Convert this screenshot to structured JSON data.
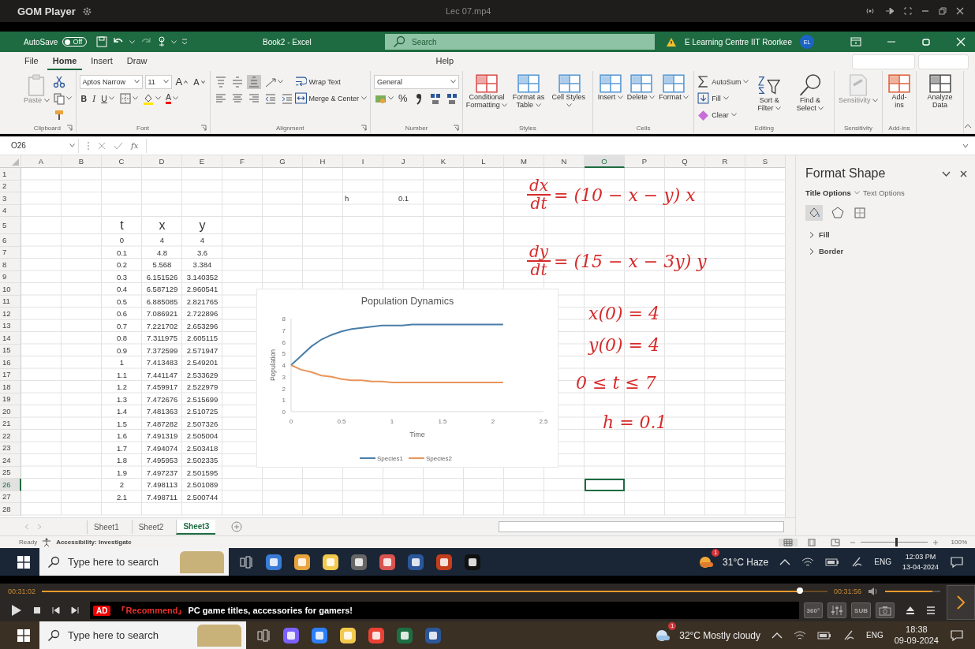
{
  "player": {
    "title": "GOM Player",
    "file": "Lec 07.mp4",
    "elapsed": "00:31:02",
    "total": "00:31:56",
    "seek": {
      "level": 0.965
    },
    "volume": {
      "level": 0.85
    },
    "ad_badge": "AD",
    "ad_tag": "『Recommend』",
    "ad_text": "PC game titles, accessories for gamers!",
    "buttons": [
      {
        "kind": "vr",
        "label": "360°"
      },
      {
        "kind": "equalizer"
      },
      {
        "kind": "subtitle",
        "label": "SUB"
      },
      {
        "kind": "capture"
      }
    ]
  },
  "excel": {
    "autosave": {
      "label": "AutoSave",
      "toggle": "Off",
      "on": false
    },
    "title": "Book2  -  Excel",
    "search": {
      "placeholder": "Search"
    },
    "account": {
      "name": "E Learning Centre IIT Roorkee",
      "initials": "EL"
    },
    "menu": [
      {
        "label": "File",
        "selected": false
      },
      {
        "label": "Home",
        "selected": true
      },
      {
        "label": "Insert",
        "selected": false
      },
      {
        "label": "Draw",
        "selected": false
      },
      {
        "label": "Help",
        "selected": false
      }
    ],
    "ribbon": [
      {
        "label": "Clipboard",
        "launcher": true,
        "blocks": [
          {
            "kind": "big",
            "label": "Paste",
            "disabled": true,
            "dropdown": true
          },
          {
            "kind": "stack",
            "lines": [
              [
                {
                  "kind": "cut"
                }
              ],
              [
                {
                  "kind": "copy",
                  "dropdown": true
                }
              ],
              [
                {
                  "kind": "painter"
                }
              ]
            ]
          }
        ]
      },
      {
        "label": "Font",
        "launcher": true,
        "blocks": [
          {
            "kind": "stack",
            "lines": [
              [
                {
                  "kind": "font-field",
                  "value": "Aptos Narrow"
                },
                {
                  "kind": "size-field",
                  "value": "11"
                },
                {
                  "kind": "grow",
                  "label": "A"
                },
                {
                  "kind": "shrink",
                  "label": "A"
                }
              ],
              [
                {
                  "kind": "bold",
                  "label": "B"
                },
                {
                  "kind": "italic",
                  "label": "I"
                },
                {
                  "kind": "underline",
                  "label": "U",
                  "dropdown": true
                },
                {
                  "kind": "borders",
                  "dropdown": true
                },
                {
                  "kind": "fill-color",
                  "dropdown": true
                },
                {
                  "kind": "font-color",
                  "label": "A",
                  "dropdown": true
                }
              ]
            ]
          }
        ]
      },
      {
        "label": "Alignment",
        "launcher": true,
        "blocks": [
          {
            "kind": "stack",
            "lines": [
              [
                {
                  "kind": "align-top",
                  "on": false
                },
                {
                  "kind": "align-middle",
                  "on": false
                },
                {
                  "kind": "align-bottom",
                  "on": true
                },
                {
                  "kind": "orientation",
                  "on": false,
                  "dropdown": true
                }
              ],
              [
                {
                  "kind": "align-left"
                },
                {
                  "kind": "align-center"
                },
                {
                  "kind": "align-right"
                },
                {
                  "kind": "indent-less"
                },
                {
                  "kind": "indent-more"
                }
              ]
            ]
          },
          {
            "kind": "stack",
            "lines": [
              [
                {
                  "kind": "small",
                  "label": "Wrap Text"
                }
              ],
              [
                {
                  "kind": "small",
                  "label": "Merge & Center",
                  "dropdown": true
                }
              ]
            ]
          }
        ]
      },
      {
        "label": "Number",
        "launcher": true,
        "blocks": [
          {
            "kind": "stack",
            "lines": [
              [
                {
                  "kind": "format-field",
                  "value": "General"
                }
              ],
              [
                {
                  "kind": "currency",
                  "dropdown": true
                },
                {
                  "kind": "percent",
                  "label": "%"
                },
                {
                  "kind": "comma"
                },
                {
                  "kind": "dec-more"
                },
                {
                  "kind": "dec-less"
                }
              ]
            ]
          }
        ]
      },
      {
        "label": "Styles",
        "launcher": false,
        "blocks": [
          {
            "kind": "big",
            "label": "Conditional Formatting",
            "disabled": false,
            "dropdown": true
          },
          {
            "kind": "big",
            "label": "Format as Table",
            "disabled": false,
            "dropdown": true
          },
          {
            "kind": "big",
            "label": "Cell Styles",
            "disabled": false,
            "dropdown": true
          }
        ]
      },
      {
        "label": "Cells",
        "launcher": false,
        "blocks": [
          {
            "kind": "big",
            "label": "Insert",
            "disabled": false,
            "dropdown": true
          },
          {
            "kind": "big",
            "label": "Delete",
            "disabled": false,
            "dropdown": true
          },
          {
            "kind": "big",
            "label": "Format",
            "disabled": false,
            "dropdown": true
          }
        ]
      },
      {
        "label": "Editing",
        "launcher": false,
        "blocks": [
          {
            "kind": "stack",
            "lines": [
              [
                {
                  "kind": "small",
                  "label": "AutoSum",
                  "dropdown": true
                }
              ],
              [
                {
                  "kind": "small",
                  "label": "Fill",
                  "dropdown": true
                }
              ],
              [
                {
                  "kind": "small",
                  "label": "Clear",
                  "dropdown": true
                }
              ]
            ]
          },
          {
            "kind": "big",
            "label": "Sort & Filter",
            "disabled": false,
            "dropdown": true
          },
          {
            "kind": "big",
            "label": "Find & Select",
            "disabled": false,
            "dropdown": true
          }
        ]
      },
      {
        "label": "Sensitivity",
        "launcher": false,
        "blocks": [
          {
            "kind": "big",
            "label": "Sensitivity",
            "disabled": true,
            "dropdown": true
          }
        ]
      },
      {
        "label": "Add-ins",
        "launcher": false,
        "blocks": [
          {
            "kind": "big",
            "label": "Add-ins",
            "disabled": false
          }
        ]
      },
      {
        "blocks": [
          {
            "kind": "big",
            "label": "Analyze Data",
            "disabled": false
          }
        ]
      }
    ],
    "formula_bar": {
      "name_box": "O26",
      "function_label": "fx"
    },
    "columns": [
      {
        "label": "A",
        "selected": false
      },
      {
        "label": "B",
        "selected": false
      },
      {
        "label": "C",
        "selected": false
      },
      {
        "label": "D",
        "selected": false
      },
      {
        "label": "E",
        "selected": false
      },
      {
        "label": "F",
        "selected": false
      },
      {
        "label": "G",
        "selected": false
      },
      {
        "label": "H",
        "selected": false
      },
      {
        "label": "I",
        "selected": false
      },
      {
        "label": "J",
        "selected": false
      },
      {
        "label": "K",
        "selected": false
      },
      {
        "label": "L",
        "selected": false
      },
      {
        "label": "M",
        "selected": false
      },
      {
        "label": "N",
        "selected": false
      },
      {
        "label": "O",
        "selected": true
      },
      {
        "label": "P",
        "selected": false
      },
      {
        "label": "Q",
        "selected": false
      },
      {
        "label": "R",
        "selected": false
      },
      {
        "label": "S",
        "selected": false
      }
    ],
    "rows": [
      {
        "label": "1",
        "selected": false
      },
      {
        "label": "2",
        "selected": false
      },
      {
        "label": "3",
        "selected": false
      },
      {
        "label": "4",
        "selected": false
      },
      {
        "label": "5",
        "selected": false
      },
      {
        "label": "6",
        "selected": false
      },
      {
        "label": "7",
        "selected": false
      },
      {
        "label": "8",
        "selected": false
      },
      {
        "label": "9",
        "selected": false
      },
      {
        "label": "10",
        "selected": false
      },
      {
        "label": "11",
        "selected": false
      },
      {
        "label": "12",
        "selected": false
      },
      {
        "label": "13",
        "selected": false
      },
      {
        "label": "14",
        "selected": false
      },
      {
        "label": "15",
        "selected": false
      },
      {
        "label": "16",
        "selected": false
      },
      {
        "label": "17",
        "selected": false
      },
      {
        "label": "18",
        "selected": false
      },
      {
        "label": "19",
        "selected": false
      },
      {
        "label": "20",
        "selected": false
      },
      {
        "label": "21",
        "selected": false
      },
      {
        "label": "22",
        "selected": false
      },
      {
        "label": "23",
        "selected": false
      },
      {
        "label": "24",
        "selected": false
      },
      {
        "label": "25",
        "selected": false
      },
      {
        "label": "26",
        "selected": true
      },
      {
        "label": "27",
        "selected": false
      },
      {
        "label": "28",
        "selected": false
      }
    ],
    "parameter": {
      "label": "h",
      "value": "0.1"
    },
    "data_table": {
      "headers": [
        "t",
        "x",
        "y"
      ],
      "rows": [
        [
          "0",
          "4",
          "4"
        ],
        [
          "0.1",
          "4.8",
          "3.6"
        ],
        [
          "0.2",
          "5.568",
          "3.384"
        ],
        [
          "0.3",
          "6.151526",
          "3.140352"
        ],
        [
          "0.4",
          "6.587129",
          "2.960541"
        ],
        [
          "0.5",
          "6.885085",
          "2.821765"
        ],
        [
          "0.6",
          "7.086921",
          "2.722896"
        ],
        [
          "0.7",
          "7.221702",
          "2.653296"
        ],
        [
          "0.8",
          "7.311975",
          "2.605115"
        ],
        [
          "0.9",
          "7.372599",
          "2.571947"
        ],
        [
          "1",
          "7.413483",
          "2.549201"
        ],
        [
          "1.1",
          "7.441147",
          "2.533629"
        ],
        [
          "1.2",
          "7.459917",
          "2.522979"
        ],
        [
          "1.3",
          "7.472676",
          "2.515699"
        ],
        [
          "1.4",
          "7.481363",
          "2.510725"
        ],
        [
          "1.5",
          "7.487282",
          "2.507326"
        ],
        [
          "1.6",
          "7.491319",
          "2.505004"
        ],
        [
          "1.7",
          "7.494074",
          "2.503418"
        ],
        [
          "1.8",
          "7.495953",
          "2.502335"
        ],
        [
          "1.9",
          "7.497237",
          "2.501595"
        ],
        [
          "2",
          "7.498113",
          "2.501089"
        ],
        [
          "2.1",
          "7.498711",
          "2.500744"
        ]
      ]
    },
    "chart": {
      "chart_data": {
        "type": "line",
        "title": "Population Dynamics",
        "xlabel": "Time",
        "ylabel": "Population",
        "x": [
          0,
          0.1,
          0.2,
          0.3,
          0.4,
          0.5,
          0.6,
          0.7,
          0.8,
          0.9,
          1,
          1.1,
          1.2,
          1.3,
          1.4,
          1.5,
          1.6,
          1.7,
          1.8,
          1.9,
          2,
          2.1
        ],
        "series": [
          {
            "name": "Species1",
            "color": "#4a7ea8",
            "values": [
              4,
              4.8,
              5.6,
              6.2,
              6.6,
              6.9,
              7.1,
              7.2,
              7.3,
              7.4,
              7.4,
              7.4,
              7.5,
              7.5,
              7.5,
              7.5,
              7.5,
              7.5,
              7.5,
              7.5,
              7.5,
              7.5
            ]
          },
          {
            "name": "Species2",
            "color": "#e8955a",
            "values": [
              4,
              3.6,
              3.4,
              3.1,
              3,
              2.8,
              2.7,
              2.7,
              2.6,
              2.6,
              2.5,
              2.5,
              2.5,
              2.5,
              2.5,
              2.5,
              2.5,
              2.5,
              2.5,
              2.5,
              2.5,
              2.5
            ]
          }
        ],
        "legend": "bottom",
        "xlim": [
          0,
          2.5
        ],
        "ylim": [
          0,
          8
        ],
        "xticks": [
          0,
          0.5,
          1,
          1.5,
          2,
          2.5
        ],
        "yticks": [
          0,
          1,
          2,
          3,
          4,
          5,
          6,
          7,
          8
        ]
      }
    },
    "notes": [
      {
        "kind": "fraction",
        "numerator": "dx",
        "denominator": "dt",
        "rest": "= (10 − x − y) x"
      },
      {
        "kind": "fraction",
        "numerator": "dy",
        "denominator": "dt",
        "rest": "= (15 − x − 3y) y"
      },
      {
        "kind": "line",
        "text": "x(0) = 4"
      },
      {
        "kind": "line",
        "text": "y(0) = 4"
      },
      {
        "kind": "line",
        "text": "0 ≤ t ≤ 7"
      },
      {
        "kind": "line",
        "text": "h = 0.1"
      }
    ],
    "pane": {
      "title": "Format Shape",
      "tabs": [
        {
          "label": "Title Options",
          "selected": true
        },
        {
          "label": "Text Options",
          "selected": false
        }
      ],
      "sections": [
        {
          "label": "Fill",
          "expanded": false
        },
        {
          "label": "Border",
          "expanded": false
        }
      ]
    },
    "sheets": [
      {
        "label": "Sheet1",
        "selected": false
      },
      {
        "label": "Sheet2",
        "selected": false
      },
      {
        "label": "Sheet3",
        "selected": true
      }
    ],
    "status": "Ready",
    "accessibility": "Accessibility: Investigate",
    "zoom": {
      "label": "100%",
      "level": 0.52
    }
  },
  "inner_taskbar": {
    "search_placeholder": "Type here to search",
    "weather": "31°C  Haze",
    "weather_badge": "1",
    "language": "ENG",
    "time": "12:03 PM",
    "date": "13-04-2024"
  },
  "outer_taskbar": {
    "search_placeholder": "Type here to search",
    "weather": "32°C  Mostly cloudy",
    "weather_badge": "1",
    "language": "ENG",
    "time": "18:38",
    "date": "09-09-2024"
  }
}
